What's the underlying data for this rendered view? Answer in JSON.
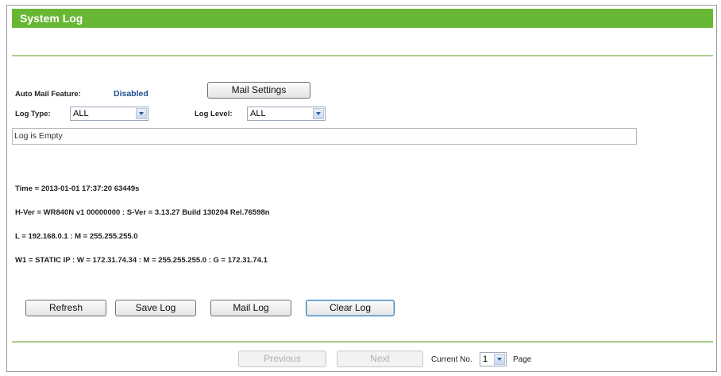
{
  "title": "System Log",
  "mail": {
    "label": "Auto Mail Feature:",
    "status": "Disabled",
    "settings_button": "Mail Settings"
  },
  "filters": {
    "log_type_label": "Log Type:",
    "log_type_value": "ALL",
    "log_level_label": "Log Level:",
    "log_level_value": "ALL"
  },
  "log": {
    "content": "Log is Empty"
  },
  "info_lines": [
    "Time = 2013-01-01 17:37:20 63449s",
    "H-Ver = WR840N v1 00000000 : S-Ver = 3.13.27 Build 130204 Rel.76598n",
    "L = 192.168.0.1 : M = 255.255.255.0",
    "W1 = STATIC IP : W = 172.31.74.34 : M = 255.255.255.0 : G = 172.31.74.1"
  ],
  "actions": {
    "refresh": "Refresh",
    "save_log": "Save Log",
    "mail_log": "Mail Log",
    "clear_log": "Clear Log"
  },
  "pagination": {
    "previous": "Previous",
    "next": "Next",
    "current_label": "Current No.",
    "current_value": "1",
    "page_label": "Page"
  },
  "colors": {
    "title_bar": "#68b734",
    "divider": "#a8d08d",
    "link": "#1f4e8c"
  }
}
